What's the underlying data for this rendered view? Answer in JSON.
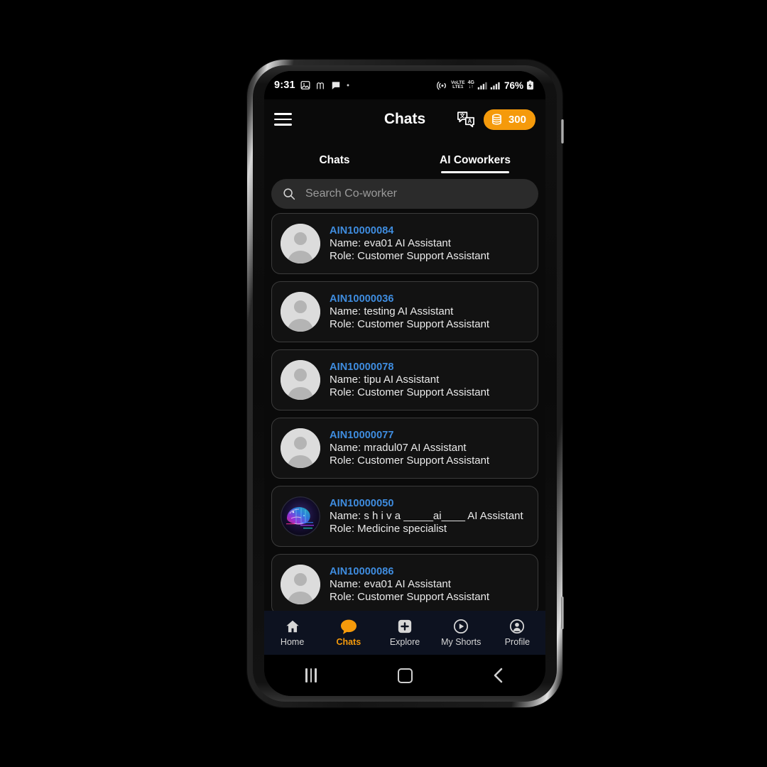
{
  "status_bar": {
    "time": "9:31",
    "left_icons": [
      "image-icon",
      "m-glyph-icon",
      "message-icon",
      "dot-icon"
    ],
    "right_icons": [
      "hotspot-icon",
      "volte-icon",
      "4g-icon",
      "signal-bars-1-icon",
      "signal-bars-2-icon"
    ],
    "volte_label": "VoLTE",
    "network_label": "4G",
    "battery_percent": "76%"
  },
  "header": {
    "title": "Chats",
    "menu_icon": "hamburger-menu-icon",
    "translate_icon": "translate-icon",
    "coin_icon": "coin-stack-icon",
    "coin_count": "300"
  },
  "tabs": [
    {
      "label": "Chats",
      "active": false
    },
    {
      "label": "AI Coworkers",
      "active": true
    }
  ],
  "search": {
    "icon": "search-icon",
    "placeholder": "Search Co-worker",
    "value": ""
  },
  "coworkers": [
    {
      "id": "AIN10000084",
      "name": "Name: eva01 AI Assistant",
      "role": "Role: Customer Support Assistant",
      "avatar": "default"
    },
    {
      "id": "AIN10000036",
      "name": "Name: testing AI Assistant",
      "role": "Role: Customer Support Assistant",
      "avatar": "default"
    },
    {
      "id": "AIN10000078",
      "name": "Name: tipu AI Assistant",
      "role": "Role: Customer Support Assistant",
      "avatar": "default"
    },
    {
      "id": "AIN10000077",
      "name": "Name: mradul07  AI Assistant",
      "role": "Role: Customer Support Assistant",
      "avatar": "default"
    },
    {
      "id": "AIN10000050",
      "name": "Name: s h i v a _____ai____ AI Assistant",
      "role": "Role: Medicine specialist",
      "avatar": "brain"
    },
    {
      "id": "AIN10000086",
      "name": "Name: eva01 AI Assistant",
      "role": "Role: Customer Support Assistant",
      "avatar": "default"
    }
  ],
  "bottom_nav": [
    {
      "label": "Home",
      "icon": "home-icon",
      "active": false
    },
    {
      "label": "Chats",
      "icon": "chat-bubble-icon",
      "active": true
    },
    {
      "label": "Explore",
      "icon": "plus-square-icon",
      "active": false
    },
    {
      "label": "My Shorts",
      "icon": "play-circle-icon",
      "active": false
    },
    {
      "label": "Profile",
      "icon": "person-circle-icon",
      "active": false
    }
  ],
  "system_nav": {
    "recents": "recents-icon",
    "home": "home-square-icon",
    "back": "back-chevron-icon"
  },
  "colors": {
    "accent": "#f59a0b",
    "id_blue": "#3f8de0",
    "screen_bg": "#0a0a0a",
    "card_bg": "#121212",
    "nav_bg": "#0d1220"
  }
}
